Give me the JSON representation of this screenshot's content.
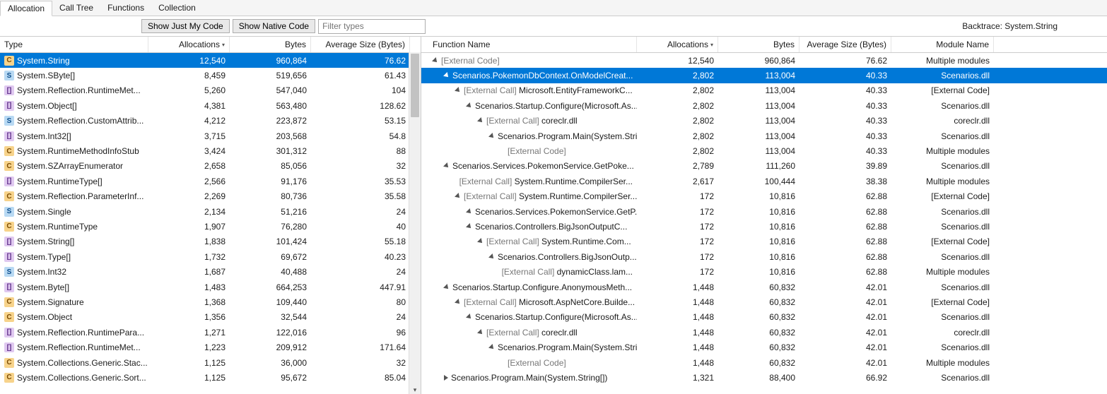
{
  "tabs": [
    "Allocation",
    "Call Tree",
    "Functions",
    "Collection"
  ],
  "active_tab": 0,
  "toolbar": {
    "show_my_code": "Show Just My Code",
    "show_native": "Show Native Code",
    "filter_placeholder": "Filter types"
  },
  "backtrace_label": "Backtrace: System.String",
  "left": {
    "columns": [
      "Type",
      "Allocations",
      "Bytes",
      "Average Size (Bytes)"
    ],
    "sort_col": 1,
    "selected": 0,
    "rows": [
      {
        "icon": "class",
        "type": "System.String",
        "alloc": "12,540",
        "bytes": "960,864",
        "avg": "76.62"
      },
      {
        "icon": "struct",
        "type": "System.SByte[]",
        "alloc": "8,459",
        "bytes": "519,656",
        "avg": "61.43"
      },
      {
        "icon": "array",
        "type": "System.Reflection.RuntimeMet...",
        "alloc": "5,260",
        "bytes": "547,040",
        "avg": "104"
      },
      {
        "icon": "array",
        "type": "System.Object[]",
        "alloc": "4,381",
        "bytes": "563,480",
        "avg": "128.62"
      },
      {
        "icon": "struct",
        "type": "System.Reflection.CustomAttrib...",
        "alloc": "4,212",
        "bytes": "223,872",
        "avg": "53.15"
      },
      {
        "icon": "array",
        "type": "System.Int32[]",
        "alloc": "3,715",
        "bytes": "203,568",
        "avg": "54.8"
      },
      {
        "icon": "class",
        "type": "System.RuntimeMethodInfoStub",
        "alloc": "3,424",
        "bytes": "301,312",
        "avg": "88"
      },
      {
        "icon": "class",
        "type": "System.SZArrayEnumerator",
        "alloc": "2,658",
        "bytes": "85,056",
        "avg": "32"
      },
      {
        "icon": "array",
        "type": "System.RuntimeType[]",
        "alloc": "2,566",
        "bytes": "91,176",
        "avg": "35.53"
      },
      {
        "icon": "class",
        "type": "System.Reflection.ParameterInf...",
        "alloc": "2,269",
        "bytes": "80,736",
        "avg": "35.58"
      },
      {
        "icon": "struct",
        "type": "System.Single",
        "alloc": "2,134",
        "bytes": "51,216",
        "avg": "24"
      },
      {
        "icon": "class",
        "type": "System.RuntimeType",
        "alloc": "1,907",
        "bytes": "76,280",
        "avg": "40"
      },
      {
        "icon": "array",
        "type": "System.String[]",
        "alloc": "1,838",
        "bytes": "101,424",
        "avg": "55.18"
      },
      {
        "icon": "array",
        "type": "System.Type[]",
        "alloc": "1,732",
        "bytes": "69,672",
        "avg": "40.23"
      },
      {
        "icon": "struct",
        "type": "System.Int32",
        "alloc": "1,687",
        "bytes": "40,488",
        "avg": "24"
      },
      {
        "icon": "array",
        "type": "System.Byte[]",
        "alloc": "1,483",
        "bytes": "664,253",
        "avg": "447.91"
      },
      {
        "icon": "class",
        "type": "System.Signature",
        "alloc": "1,368",
        "bytes": "109,440",
        "avg": "80"
      },
      {
        "icon": "class",
        "type": "System.Object",
        "alloc": "1,356",
        "bytes": "32,544",
        "avg": "24"
      },
      {
        "icon": "array",
        "type": "System.Reflection.RuntimePara...",
        "alloc": "1,271",
        "bytes": "122,016",
        "avg": "96"
      },
      {
        "icon": "array",
        "type": "System.Reflection.RuntimeMet...",
        "alloc": "1,223",
        "bytes": "209,912",
        "avg": "171.64"
      },
      {
        "icon": "class",
        "type": "System.Collections.Generic.Stac...",
        "alloc": "1,125",
        "bytes": "36,000",
        "avg": "32"
      },
      {
        "icon": "class",
        "type": "System.Collections.Generic.Sort...",
        "alloc": "1,125",
        "bytes": "95,672",
        "avg": "85.04"
      }
    ]
  },
  "right": {
    "columns": [
      "Function Name",
      "Allocations",
      "Bytes",
      "Average Size (Bytes)",
      "Module Name"
    ],
    "sort_col": 1,
    "selected": 1,
    "rows": [
      {
        "indent": 0,
        "tri": "open",
        "ext": true,
        "name": "[External Code]",
        "alloc": "12,540",
        "bytes": "960,864",
        "avg": "76.62",
        "mod": "Multiple modules"
      },
      {
        "indent": 1,
        "tri": "open",
        "ext": false,
        "name": "Scenarios.PokemonDbContext.OnModelCreat...",
        "alloc": "2,802",
        "bytes": "113,004",
        "avg": "40.33",
        "mod": "Scenarios.dll"
      },
      {
        "indent": 2,
        "tri": "open",
        "ext": true,
        "extprefix": true,
        "name": "Microsoft.EntityFrameworkC...",
        "alloc": "2,802",
        "bytes": "113,004",
        "avg": "40.33",
        "mod": "[External Code]"
      },
      {
        "indent": 3,
        "tri": "open",
        "ext": false,
        "name": "Scenarios.Startup.Configure(Microsoft.As...",
        "alloc": "2,802",
        "bytes": "113,004",
        "avg": "40.33",
        "mod": "Scenarios.dll"
      },
      {
        "indent": 4,
        "tri": "open",
        "ext": true,
        "extprefix": true,
        "name": "coreclr.dll",
        "alloc": "2,802",
        "bytes": "113,004",
        "avg": "40.33",
        "mod": "coreclr.dll"
      },
      {
        "indent": 5,
        "tri": "open",
        "ext": false,
        "name": "Scenarios.Program.Main(System.Stri...",
        "alloc": "2,802",
        "bytes": "113,004",
        "avg": "40.33",
        "mod": "Scenarios.dll"
      },
      {
        "indent": 6,
        "tri": "none",
        "ext": true,
        "name": "[External Code]",
        "alloc": "2,802",
        "bytes": "113,004",
        "avg": "40.33",
        "mod": "Multiple modules"
      },
      {
        "indent": 1,
        "tri": "open",
        "ext": false,
        "name": "Scenarios.Services.PokemonService.GetPoke...",
        "alloc": "2,789",
        "bytes": "111,260",
        "avg": "39.89",
        "mod": "Scenarios.dll"
      },
      {
        "indent": 2,
        "tri": "none",
        "ext": true,
        "extprefix": true,
        "name": "System.Runtime.CompilerSer...",
        "alloc": "2,617",
        "bytes": "100,444",
        "avg": "38.38",
        "mod": "Multiple modules"
      },
      {
        "indent": 2,
        "tri": "open",
        "ext": true,
        "extprefix": true,
        "name": "System.Runtime.CompilerSer...",
        "alloc": "172",
        "bytes": "10,816",
        "avg": "62.88",
        "mod": "[External Code]"
      },
      {
        "indent": 3,
        "tri": "open",
        "ext": false,
        "name": "Scenarios.Services.PokemonService.GetP...",
        "alloc": "172",
        "bytes": "10,816",
        "avg": "62.88",
        "mod": "Scenarios.dll"
      },
      {
        "indent": 3,
        "tri": "open",
        "ext": false,
        "name": "Scenarios.Controllers.BigJsonOutputC...",
        "alloc": "172",
        "bytes": "10,816",
        "avg": "62.88",
        "mod": "Scenarios.dll"
      },
      {
        "indent": 4,
        "tri": "open",
        "ext": true,
        "extprefix": true,
        "name": "System.Runtime.Com...",
        "alloc": "172",
        "bytes": "10,816",
        "avg": "62.88",
        "mod": "[External Code]"
      },
      {
        "indent": 5,
        "tri": "open",
        "ext": false,
        "name": "Scenarios.Controllers.BigJsonOutp...",
        "alloc": "172",
        "bytes": "10,816",
        "avg": "62.88",
        "mod": "Scenarios.dll"
      },
      {
        "indent": 6,
        "tri": "none",
        "ext": true,
        "extprefix": true,
        "name": "dynamicClass.lam...",
        "alloc": "172",
        "bytes": "10,816",
        "avg": "62.88",
        "mod": "Multiple modules"
      },
      {
        "indent": 1,
        "tri": "open",
        "ext": false,
        "name": "Scenarios.Startup.Configure.AnonymousMeth...",
        "alloc": "1,448",
        "bytes": "60,832",
        "avg": "42.01",
        "mod": "Scenarios.dll"
      },
      {
        "indent": 2,
        "tri": "open",
        "ext": true,
        "extprefix": true,
        "name": "Microsoft.AspNetCore.Builde...",
        "alloc": "1,448",
        "bytes": "60,832",
        "avg": "42.01",
        "mod": "[External Code]"
      },
      {
        "indent": 3,
        "tri": "open",
        "ext": false,
        "name": "Scenarios.Startup.Configure(Microsoft.As...",
        "alloc": "1,448",
        "bytes": "60,832",
        "avg": "42.01",
        "mod": "Scenarios.dll"
      },
      {
        "indent": 4,
        "tri": "open",
        "ext": true,
        "extprefix": true,
        "name": "coreclr.dll",
        "alloc": "1,448",
        "bytes": "60,832",
        "avg": "42.01",
        "mod": "coreclr.dll"
      },
      {
        "indent": 5,
        "tri": "open",
        "ext": false,
        "name": "Scenarios.Program.Main(System.Stri...",
        "alloc": "1,448",
        "bytes": "60,832",
        "avg": "42.01",
        "mod": "Scenarios.dll"
      },
      {
        "indent": 6,
        "tri": "none",
        "ext": true,
        "name": "[External Code]",
        "alloc": "1,448",
        "bytes": "60,832",
        "avg": "42.01",
        "mod": "Multiple modules"
      },
      {
        "indent": 1,
        "tri": "closed",
        "ext": false,
        "name": "Scenarios.Program.Main(System.String[])",
        "alloc": "1,321",
        "bytes": "88,400",
        "avg": "66.92",
        "mod": "Scenarios.dll"
      }
    ]
  }
}
